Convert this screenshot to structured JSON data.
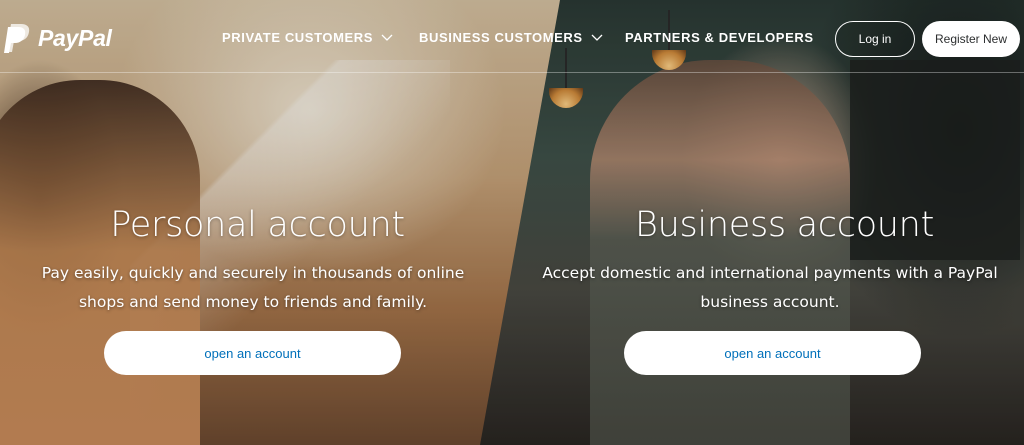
{
  "brand": {
    "name": "PayPal"
  },
  "nav": {
    "items": [
      {
        "label": "PRIVATE CUSTOMERS",
        "has_dropdown": true
      },
      {
        "label": "BUSINESS CUSTOMERS",
        "has_dropdown": true
      },
      {
        "label": "PARTNERS & DEVELOPERS",
        "has_dropdown": false
      }
    ],
    "login_label": "Log in",
    "register_label": "Register New"
  },
  "personal": {
    "title": "Personal account",
    "description": "Pay easily, quickly and securely in thousands of online shops and send money to friends and family.",
    "cta_label": "open an account"
  },
  "business": {
    "title": "Business account",
    "description": "Accept domestic and international payments with a PayPal business account.",
    "cta_label": "open an account"
  },
  "colors": {
    "accent": "#0070ba",
    "button_bg": "#ffffff",
    "text_on_image": "#ffffff"
  }
}
